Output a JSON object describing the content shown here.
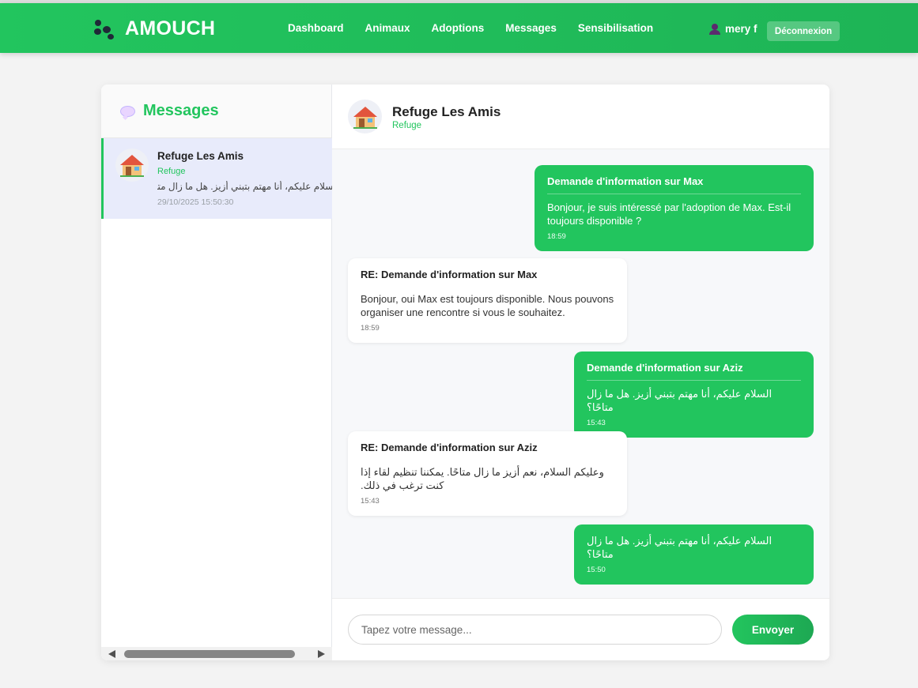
{
  "colors": {
    "accent": "#22c55e",
    "bubble_sent": "#22c55e",
    "bubble_received": "#ffffff",
    "selected_conversation": "#e8ebfb"
  },
  "header": {
    "brand_icon": "paw-icon",
    "brand": "AMOUCH",
    "nav": [
      "Dashboard",
      "Animaux",
      "Adoptions",
      "Messages",
      "Sensibilisation"
    ],
    "user_icon": "user-icon",
    "user_name": "mery f",
    "logout_label": "Déconnexion"
  },
  "sidebar": {
    "title_icon": "speech-bubble-icon",
    "title": "Messages",
    "conversations": [
      {
        "avatar_icon": "house-icon",
        "name": "Refuge Les Amis",
        "role": "Refuge",
        "preview": "السلام عليكم، أنا مهتم بتبني أزيز. هل ما زال متاحًا؟",
        "time": "29/10/2025 15:50:30"
      }
    ]
  },
  "chat": {
    "avatar_icon": "house-icon",
    "name": "Refuge Les Amis",
    "role": "Refuge",
    "messages": [
      {
        "direction": "sent",
        "subject": "Demande d'information sur Max",
        "text": "Bonjour, je suis intéressé par l'adoption de Max. Est-il toujours disponible ?",
        "time": "18:59"
      },
      {
        "direction": "received",
        "subject": "RE: Demande d'information sur Max",
        "text": "Bonjour, oui Max est toujours disponible. Nous pouvons organiser une rencontre si vous le souhaitez.",
        "time": "18:59"
      },
      {
        "direction": "sent",
        "subject": "Demande d'information sur Aziz",
        "text": "السلام عليكم، أنا مهتم بتبني أزيز. هل ما زال متاحًا؟",
        "time": "15:43"
      },
      {
        "direction": "received",
        "subject": "RE: Demande d'information sur Aziz",
        "text": "وعليكم السلام، نعم أزيز ما زال متاحًا. يمكننا تنظيم لقاء إذا كنت ترغب في ذلك.",
        "time": "15:43"
      },
      {
        "direction": "sent",
        "subject": "",
        "text": "السلام عليكم، أنا مهتم بتبني أزيز. هل ما زال متاحًا؟",
        "time": "15:50"
      }
    ],
    "input_placeholder": "Tapez votre message...",
    "input_value": "",
    "send_label": "Envoyer"
  }
}
